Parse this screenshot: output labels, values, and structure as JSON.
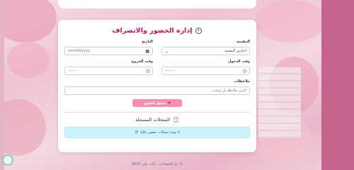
{
  "form": {
    "title": "إدارة الحضور والانصراف",
    "fields": {
      "date_label": "التاريخ",
      "date_placeholder": "mm/dd/yyyy",
      "stage_label": "المقيمة",
      "stage_value": "اختاري المقيمة",
      "checkin_label": "وقت الدخول",
      "checkin_placeholder": "--:-- --",
      "checkout_label": "وقت الخروج",
      "checkout_placeholder": "--:-- --",
      "notes_label": "ملاحظات",
      "notes_placeholder": "اكتبي ملاحظة إن وجدت"
    },
    "submit_label": "تسجيل الحضور"
  },
  "records": {
    "title": "السجلات المسجلة",
    "empty_message": "لا توجد سجلات حضور حاليا"
  },
  "footer": {
    "text": "© دار الحضانات - آيات علي 2025"
  },
  "colors": {
    "accent": "#c2185b",
    "button": "#f48fb1",
    "alert_bg": "#cdf4fb"
  }
}
